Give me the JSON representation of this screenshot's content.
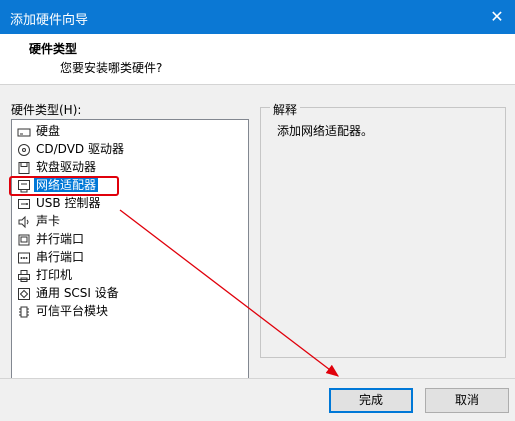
{
  "window": {
    "title": "添加硬件向导"
  },
  "header": {
    "heading": "硬件类型",
    "question": "您要安装哪类硬件?"
  },
  "list": {
    "label": "硬件类型(H):",
    "items": [
      {
        "label": "硬盘",
        "icon": "hard-disk-icon"
      },
      {
        "label": "CD/DVD 驱动器",
        "icon": "cd-dvd-icon"
      },
      {
        "label": "软盘驱动器",
        "icon": "floppy-icon"
      },
      {
        "label": "网络适配器",
        "icon": "network-adapter-icon",
        "selected": true
      },
      {
        "label": "USB 控制器",
        "icon": "usb-icon"
      },
      {
        "label": "声卡",
        "icon": "speaker-icon"
      },
      {
        "label": "并行端口",
        "icon": "parallel-port-icon"
      },
      {
        "label": "串行端口",
        "icon": "serial-port-icon"
      },
      {
        "label": "打印机",
        "icon": "printer-icon"
      },
      {
        "label": "通用 SCSI 设备",
        "icon": "scsi-icon"
      },
      {
        "label": "可信平台模块",
        "icon": "tpm-icon"
      }
    ]
  },
  "explanation": {
    "title": "解释",
    "text": "添加网络适配器。"
  },
  "buttons": {
    "finish": "完成",
    "cancel": "取消"
  },
  "colors": {
    "titlebar": "#0b78d4",
    "selection": "#0078d7",
    "annotation": "#e0000b"
  }
}
